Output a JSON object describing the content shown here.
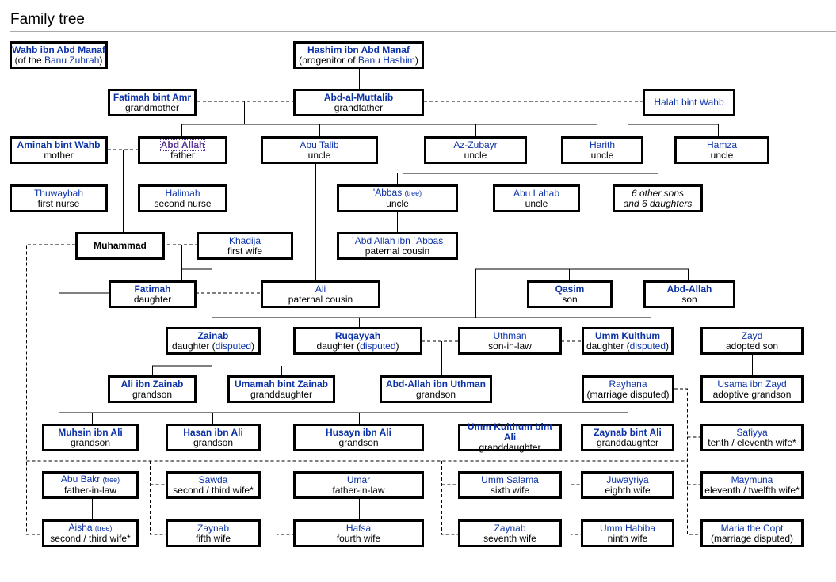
{
  "title": "Family tree",
  "colors": {
    "link": "#0b32a8",
    "visited": "#5a3696",
    "line": "#000000",
    "rule": "#aaaaaa"
  },
  "nodes": {
    "wahb": {
      "name": "Wahb ibn Abd Manaf",
      "sub_pre": "(of the ",
      "sub_link": "Banu Zuhrah",
      "sub_post": ")"
    },
    "hashim": {
      "name": "Hashim ibn Abd Manaf",
      "sub_pre": "(progenitor of ",
      "sub_link": "Banu Hashim",
      "sub_post": ")"
    },
    "fatimah_amr": {
      "name": "Fatimah bint Amr",
      "sub": "grandmother"
    },
    "abd_muttalib": {
      "name": "Abd-al-Muttalib",
      "sub": "grandfather"
    },
    "halah": {
      "name": "Halah bint Wahb"
    },
    "aminah": {
      "name": "Aminah bint Wahb",
      "sub": "mother"
    },
    "abd_allah": {
      "name": "Abd Allah",
      "sub": "father"
    },
    "abu_talib": {
      "name": "Abu Talib",
      "sub": "uncle"
    },
    "az_zubayr": {
      "name": "Az-Zubayr",
      "sub": "uncle"
    },
    "harith": {
      "name": "Harith",
      "sub": "uncle"
    },
    "hamza": {
      "name": "Hamza",
      "sub": "uncle"
    },
    "thuwaybah": {
      "name": "Thuwaybah",
      "sub": "first nurse"
    },
    "halimah": {
      "name": "Halimah",
      "sub": "second nurse"
    },
    "abbas": {
      "name": "'Abbas",
      "tree": "(tree)",
      "sub": "uncle"
    },
    "abu_lahab": {
      "name": "Abu Lahab",
      "sub": "uncle"
    },
    "other_children": {
      "line1": "6 other sons",
      "line2": "and 6 daughters"
    },
    "muhammad": {
      "name": "Muhammad"
    },
    "khadija": {
      "name": "Khadija",
      "sub": "first wife"
    },
    "abd_allah_abbas": {
      "name": "`Abd Allah ibn `Abbas",
      "sub": "paternal cousin"
    },
    "fatimah": {
      "name": "Fatimah",
      "sub": "daughter"
    },
    "ali": {
      "name": "Ali",
      "sub": "paternal cousin"
    },
    "qasim": {
      "name": "Qasim",
      "sub": "son"
    },
    "abd_allah_son": {
      "name": "Abd-Allah",
      "sub": "son"
    },
    "zainab": {
      "name": "Zainab",
      "sub_pre": "daughter (",
      "sub_link": "disputed",
      "sub_post": ")"
    },
    "ruqayyah": {
      "name": "Ruqayyah",
      "sub_pre": "daughter (",
      "sub_link": "disputed",
      "sub_post": ")"
    },
    "uthman": {
      "name": "Uthman",
      "sub": "son-in-law"
    },
    "umm_kulthum": {
      "name": "Umm Kulthum",
      "sub_pre": "daughter (",
      "sub_link": "disputed",
      "sub_post": ")"
    },
    "zayd": {
      "name": "Zayd",
      "sub": "adopted son"
    },
    "ali_zainab": {
      "name": "Ali ibn Zainab",
      "sub": "grandson"
    },
    "umamah": {
      "name": "Umamah bint Zainab",
      "sub": "granddaughter"
    },
    "abd_allah_uthman": {
      "name": "Abd-Allah ibn Uthman",
      "sub": "grandson"
    },
    "rayhana": {
      "name": "Rayhana",
      "sub": "(marriage disputed)"
    },
    "usama": {
      "name": "Usama ibn Zayd",
      "sub": "adoptive grandson"
    },
    "muhsin": {
      "name": "Muhsin ibn Ali",
      "sub": "grandson"
    },
    "hasan": {
      "name": "Hasan ibn Ali",
      "sub": "grandson"
    },
    "husayn": {
      "name": "Husayn ibn Ali",
      "sub": "grandson"
    },
    "umm_kulthum_ali": {
      "name": "Umm Kulthum bint Ali",
      "sub": "granddaughter"
    },
    "zaynab_ali": {
      "name": "Zaynab bint Ali",
      "sub": "granddaughter"
    },
    "safiyya": {
      "name": "Safiyya",
      "sub": "tenth / eleventh wife*"
    },
    "abu_bakr": {
      "name": "Abu Bakr",
      "tree": "(tree)",
      "sub": "father-in-law"
    },
    "sawda": {
      "name": "Sawda",
      "sub": "second / third wife*"
    },
    "umar": {
      "name": "Umar",
      "sub": "father-in-law"
    },
    "umm_salama": {
      "name": "Umm Salama",
      "sub": "sixth wife"
    },
    "juwayriya": {
      "name": "Juwayriya",
      "sub": "eighth wife"
    },
    "maymuna": {
      "name": "Maymuna",
      "sub": "eleventh / twelfth wife*"
    },
    "aisha": {
      "name": "Aisha",
      "tree": "(tree)",
      "sub": "second / third wife*"
    },
    "zaynab_wife": {
      "name": "Zaynab",
      "sub": "fifth wife"
    },
    "hafsa": {
      "name": "Hafsa",
      "sub": "fourth wife"
    },
    "zaynab_seventh": {
      "name": "Zaynab",
      "sub": "seventh wife"
    },
    "umm_habiba": {
      "name": "Umm Habiba",
      "sub": "ninth wife"
    },
    "maria": {
      "name": "Maria the Copt",
      "sub": "(marriage disputed)"
    }
  }
}
